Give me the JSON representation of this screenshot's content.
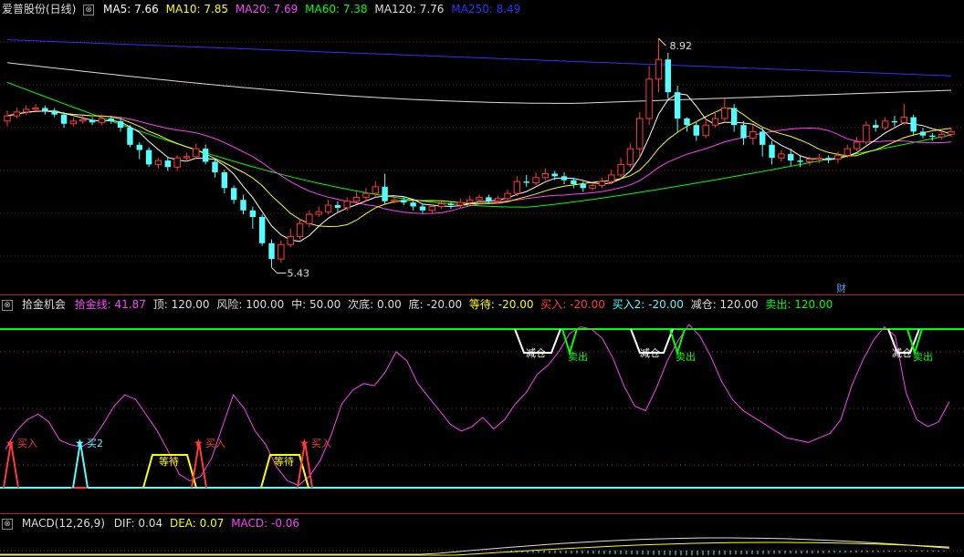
{
  "price": {
    "title": "爱普股份(日线)",
    "ma": [
      {
        "label": "MA5: 7.66",
        "color": "#ffffff"
      },
      {
        "label": "MA10: 7.85",
        "color": "#ffff00"
      },
      {
        "label": "MA20: 7.69",
        "color": "#ff40ff"
      },
      {
        "label": "MA60: 7.38",
        "color": "#00ff00"
      },
      {
        "label": "MA120: 7.76",
        "color": "#dddddd"
      },
      {
        "label": "MA250: 8.49",
        "color": "#3030ff"
      }
    ],
    "high_label": "8.92",
    "low_label": "5.43",
    "cai_label": "财",
    "up_color": "#ff3b3b",
    "down_color": "#54ffff"
  },
  "osc": {
    "name": "拾金机会",
    "items": [
      {
        "label": "拾金线: 41.87",
        "color": "#ff40ff"
      },
      {
        "label": "顶: 120.00",
        "color": "#dddddd"
      },
      {
        "label": "风险: 100.00",
        "color": "#dddddd"
      },
      {
        "label": "中: 50.00",
        "color": "#dddddd"
      },
      {
        "label": "次底: 0.00",
        "color": "#dddddd"
      },
      {
        "label": "底: -20.00",
        "color": "#dddddd"
      },
      {
        "label": "等待: -20.00",
        "color": "#ffff00"
      },
      {
        "label": "买入: -20.00",
        "color": "#ff3b3b"
      },
      {
        "label": "买入2: -20.00",
        "color": "#54ffff"
      },
      {
        "label": "减仓: 120.00",
        "color": "#dddddd"
      },
      {
        "label": "卖出: 120.00",
        "color": "#00ff00"
      }
    ],
    "signals": {
      "buy": "买入",
      "buy2": "买2",
      "wait": "等待",
      "reduce": "减仓",
      "sell": "卖出"
    }
  },
  "macd": {
    "name": "MACD(12,26,9)",
    "items": [
      {
        "label": "DIF: 0.04",
        "color": "#dddddd"
      },
      {
        "label": "DEA: 0.07",
        "color": "#ffff00"
      },
      {
        "label": "MACD: -0.06",
        "color": "#ff40ff"
      }
    ]
  },
  "chart_data": [
    {
      "type": "candlestick",
      "title": "爱普股份(日线)",
      "candles": [
        [
          7.66,
          7.74,
          7.82,
          7.58
        ],
        [
          7.74,
          7.8,
          7.86,
          7.7
        ],
        [
          7.8,
          7.84,
          7.9,
          7.76
        ],
        [
          7.84,
          7.86,
          7.92,
          7.8
        ],
        [
          7.86,
          7.82,
          7.9,
          7.76
        ],
        [
          7.82,
          7.76,
          7.86,
          7.72
        ],
        [
          7.76,
          7.62,
          7.8,
          7.56
        ],
        [
          7.62,
          7.66,
          7.72,
          7.58
        ],
        [
          7.66,
          7.68,
          7.74,
          7.62
        ],
        [
          7.68,
          7.64,
          7.72,
          7.6
        ],
        [
          7.64,
          7.7,
          7.76,
          7.6
        ],
        [
          7.7,
          7.66,
          7.74,
          7.62
        ],
        [
          7.66,
          7.56,
          7.72,
          7.5
        ],
        [
          7.56,
          7.3,
          7.6,
          7.26
        ],
        [
          7.3,
          7.22,
          7.34,
          7.08
        ],
        [
          7.22,
          7.0,
          7.26,
          6.96
        ],
        [
          7.0,
          7.06,
          7.1,
          6.94
        ],
        [
          7.06,
          6.96,
          7.12,
          6.9
        ],
        [
          6.96,
          7.1,
          7.14,
          6.9
        ],
        [
          7.1,
          7.12,
          7.18,
          7.04
        ],
        [
          7.12,
          7.24,
          7.32,
          7.08
        ],
        [
          7.24,
          7.04,
          7.3,
          7.0
        ],
        [
          7.04,
          6.88,
          7.08,
          6.8
        ],
        [
          6.88,
          6.64,
          6.92,
          6.56
        ],
        [
          6.64,
          6.46,
          6.68,
          6.4
        ],
        [
          6.46,
          6.3,
          6.54,
          6.24
        ],
        [
          6.3,
          6.2,
          6.36,
          6.02
        ],
        [
          6.2,
          5.8,
          6.24,
          5.76
        ],
        [
          5.8,
          5.56,
          5.86,
          5.43
        ],
        [
          5.56,
          5.78,
          5.84,
          5.5
        ],
        [
          5.78,
          5.9,
          6.02,
          5.74
        ],
        [
          5.9,
          6.1,
          6.18,
          5.86
        ],
        [
          6.1,
          6.24,
          6.3,
          6.04
        ],
        [
          6.24,
          6.28,
          6.36,
          6.2
        ],
        [
          6.28,
          6.38,
          6.46,
          6.24
        ],
        [
          6.38,
          6.34,
          6.44,
          6.28
        ],
        [
          6.34,
          6.44,
          6.5,
          6.3
        ],
        [
          6.44,
          6.5,
          6.58,
          6.4
        ],
        [
          6.5,
          6.56,
          6.64,
          6.44
        ],
        [
          6.56,
          6.66,
          6.74,
          6.5
        ],
        [
          6.66,
          6.44,
          6.86,
          6.4
        ],
        [
          6.44,
          6.46,
          6.52,
          6.4
        ],
        [
          6.46,
          6.42,
          6.5,
          6.38
        ],
        [
          6.42,
          6.36,
          6.46,
          6.3
        ],
        [
          6.36,
          6.3,
          6.4,
          6.26
        ],
        [
          6.3,
          6.36,
          6.4,
          6.26
        ],
        [
          6.36,
          6.4,
          6.44,
          6.32
        ],
        [
          6.4,
          6.38,
          6.44,
          6.32
        ],
        [
          6.38,
          6.42,
          6.48,
          6.34
        ],
        [
          6.42,
          6.46,
          6.52,
          6.38
        ],
        [
          6.46,
          6.5,
          6.54,
          6.42
        ],
        [
          6.5,
          6.44,
          6.54,
          6.4
        ],
        [
          6.44,
          6.48,
          6.52,
          6.4
        ],
        [
          6.48,
          6.56,
          6.62,
          6.44
        ],
        [
          6.56,
          6.74,
          6.82,
          6.52
        ],
        [
          6.74,
          6.72,
          6.84,
          6.66
        ],
        [
          6.72,
          6.8,
          6.88,
          6.68
        ],
        [
          6.8,
          6.86,
          6.94,
          6.76
        ],
        [
          6.86,
          6.82,
          6.9,
          6.76
        ],
        [
          6.82,
          6.76,
          6.88,
          6.7
        ],
        [
          6.76,
          6.7,
          6.8,
          6.64
        ],
        [
          6.7,
          6.64,
          6.74,
          6.58
        ],
        [
          6.64,
          6.68,
          6.72,
          6.6
        ],
        [
          6.68,
          6.74,
          6.8,
          6.64
        ],
        [
          6.74,
          6.84,
          6.92,
          6.7
        ],
        [
          6.84,
          7.0,
          7.1,
          6.8
        ],
        [
          7.0,
          7.24,
          7.32,
          6.96
        ],
        [
          7.24,
          7.7,
          7.8,
          7.1
        ],
        [
          7.7,
          8.3,
          8.5,
          7.6
        ],
        [
          8.3,
          8.6,
          8.92,
          8.1
        ],
        [
          8.6,
          8.1,
          8.7,
          8.0
        ],
        [
          8.1,
          7.7,
          8.2,
          7.5
        ],
        [
          7.7,
          7.6,
          7.72,
          7.5
        ],
        [
          7.6,
          7.44,
          7.64,
          7.36
        ],
        [
          7.44,
          7.6,
          7.7,
          7.4
        ],
        [
          7.6,
          7.7,
          7.8,
          7.56
        ],
        [
          7.7,
          7.86,
          8.0,
          7.64
        ],
        [
          7.86,
          7.6,
          7.92,
          7.5
        ],
        [
          7.6,
          7.4,
          7.66,
          7.3
        ],
        [
          7.4,
          7.5,
          7.6,
          7.3
        ],
        [
          7.5,
          7.3,
          7.56,
          7.12
        ],
        [
          7.3,
          7.1,
          7.36,
          7.0
        ],
        [
          7.1,
          7.16,
          7.22,
          7.04
        ],
        [
          7.16,
          7.06,
          7.24,
          6.98
        ],
        [
          7.06,
          7.04,
          7.14,
          6.96
        ],
        [
          7.04,
          7.08,
          7.12,
          6.98
        ],
        [
          7.08,
          7.1,
          7.16,
          7.02
        ],
        [
          7.1,
          7.08,
          7.14,
          7.02
        ],
        [
          7.08,
          7.14,
          7.2,
          7.02
        ],
        [
          7.14,
          7.24,
          7.3,
          7.1
        ],
        [
          7.24,
          7.34,
          7.42,
          7.2
        ],
        [
          7.34,
          7.6,
          7.66,
          7.3
        ],
        [
          7.6,
          7.56,
          7.68,
          7.5
        ],
        [
          7.56,
          7.66,
          7.72,
          7.52
        ],
        [
          7.66,
          7.64,
          7.74,
          7.58
        ],
        [
          7.64,
          7.72,
          7.92,
          7.6
        ],
        [
          7.72,
          7.5,
          7.76,
          7.44
        ],
        [
          7.5,
          7.44,
          7.56,
          7.4
        ],
        [
          7.44,
          7.42,
          7.48,
          7.36
        ],
        [
          7.42,
          7.46,
          7.52,
          7.38
        ],
        [
          7.46,
          7.5,
          7.56,
          7.42
        ]
      ],
      "ma_names": [
        "MA5",
        "MA10",
        "MA20",
        "MA60",
        "MA120",
        "MA250"
      ],
      "ma_last": [
        7.66,
        7.85,
        7.69,
        7.38,
        7.76,
        8.49
      ],
      "marks": {
        "high": 8.92,
        "low": 5.43
      }
    },
    {
      "type": "line",
      "title": "拾金机会",
      "series_name": "拾金线",
      "values": [
        14,
        30,
        40,
        45,
        38,
        22,
        18,
        16,
        22,
        36,
        52,
        62,
        58,
        44,
        30,
        12,
        -8,
        -14,
        -10,
        6,
        34,
        62,
        50,
        30,
        18,
        -2,
        -14,
        -18,
        -10,
        4,
        26,
        54,
        66,
        72,
        70,
        82,
        100,
        92,
        72,
        60,
        48,
        36,
        30,
        34,
        42,
        32,
        40,
        54,
        64,
        80,
        88,
        100,
        116,
        122,
        120,
        112,
        94,
        70,
        52,
        48,
        68,
        92,
        110,
        124,
        114,
        96,
        74,
        58,
        48,
        42,
        36,
        30,
        24,
        22,
        20,
        24,
        28,
        40,
        70,
        92,
        110,
        122,
        114,
        64,
        40,
        34,
        38,
        56
      ],
      "levels": {
        "顶": 120,
        "风险": 100,
        "中": 50,
        "次底": 0,
        "底": -20
      }
    },
    {
      "type": "line",
      "title": "MACD(12,26,9)",
      "series": [
        {
          "name": "DIF",
          "last": 0.04
        },
        {
          "name": "DEA",
          "last": 0.07
        },
        {
          "name": "MACD",
          "last": -0.06
        }
      ]
    }
  ]
}
